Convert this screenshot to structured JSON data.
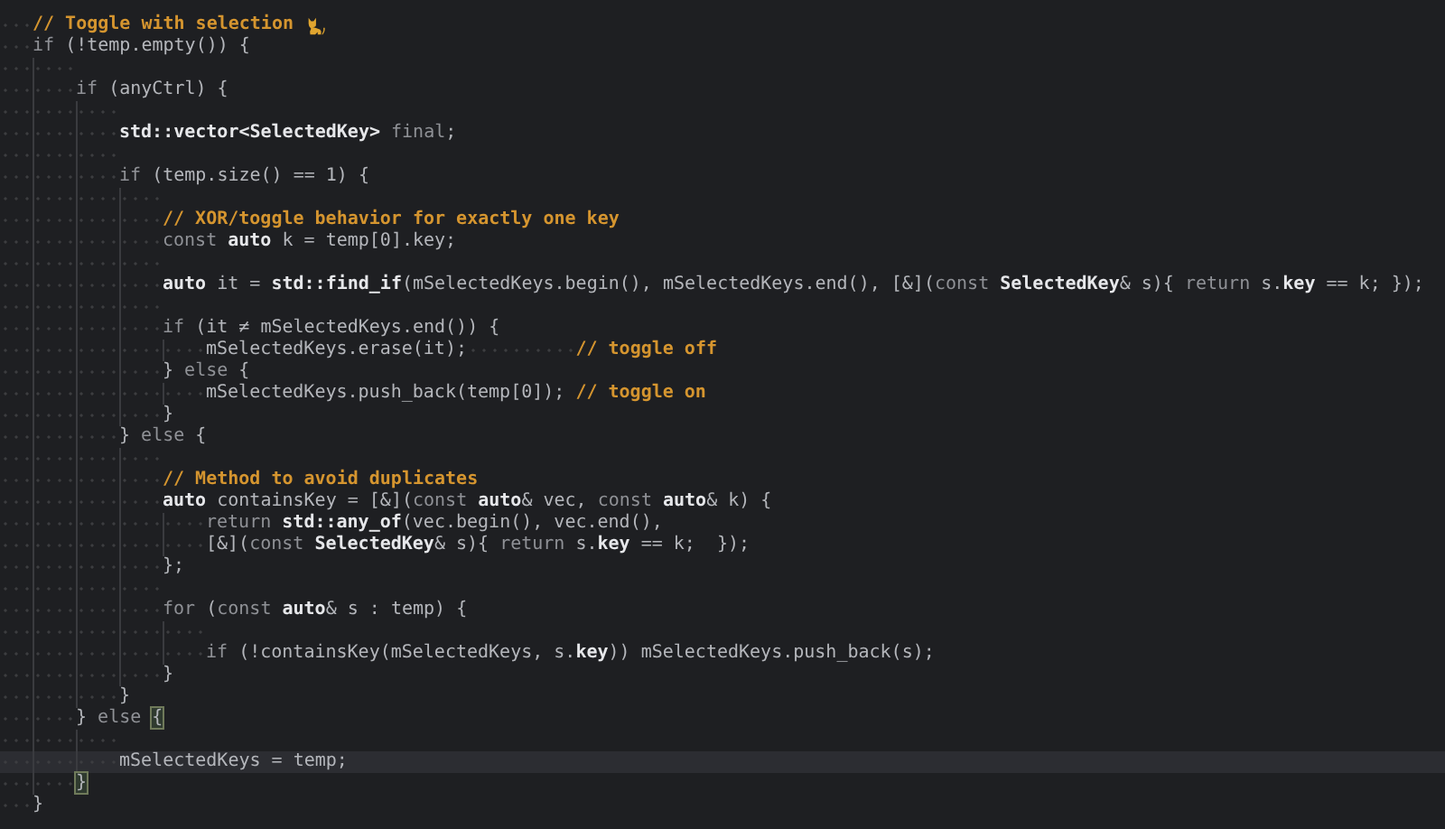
{
  "lines": [
    {
      "kind": "code",
      "current": false,
      "tokens": [
        {
          "kind": "comment",
          "text": "// Toggle with selection"
        },
        {
          "kind": "icon"
        }
      ]
    },
    {
      "kind": "code",
      "current": false,
      "tokens": [
        {
          "kind": "keyword",
          "text": "if"
        },
        {
          "kind": "plain",
          "text": " (!temp.empty()) {"
        }
      ],
      "children": [
        {
          "kind": "blank",
          "current": false
        },
        {
          "kind": "code",
          "current": false,
          "tokens": [
            {
              "kind": "keyword",
              "text": "if"
            },
            {
              "kind": "plain",
              "text": " (anyCtrl) {"
            }
          ],
          "children": [
            {
              "kind": "blank",
              "current": false
            },
            {
              "kind": "code",
              "current": false,
              "tokens": [
                {
                  "kind": "strong",
                  "text": "std::vector<SelectedKey>"
                },
                {
                  "kind": "keyword",
                  "text": " final"
                },
                {
                  "kind": "plain",
                  "text": ";"
                }
              ]
            },
            {
              "kind": "blank",
              "current": false
            },
            {
              "kind": "code",
              "current": false,
              "tokens": [
                {
                  "kind": "keyword",
                  "text": "if"
                },
                {
                  "kind": "plain",
                  "text": " (temp.size() == 1) {"
                }
              ],
              "children": [
                {
                  "kind": "blank",
                  "current": false
                },
                {
                  "kind": "code",
                  "current": false,
                  "tokens": [
                    {
                      "kind": "comment",
                      "text": "// XOR/toggle behavior for exactly one key"
                    }
                  ]
                },
                {
                  "kind": "code",
                  "current": false,
                  "tokens": [
                    {
                      "kind": "keyword",
                      "text": "const "
                    },
                    {
                      "kind": "strong",
                      "text": "auto"
                    },
                    {
                      "kind": "plain",
                      "text": " k = temp[0].key;"
                    }
                  ]
                },
                {
                  "kind": "blank",
                  "current": false
                },
                {
                  "kind": "code",
                  "current": false,
                  "tokens": [
                    {
                      "kind": "strong",
                      "text": "auto"
                    },
                    {
                      "kind": "plain",
                      "text": " it = "
                    },
                    {
                      "kind": "strong",
                      "text": "std::find_if"
                    },
                    {
                      "kind": "plain",
                      "text": "(mSelectedKeys.begin(), mSelectedKeys.end(), [&]("
                    },
                    {
                      "kind": "keyword",
                      "text": "const "
                    },
                    {
                      "kind": "strong",
                      "text": "SelectedKey"
                    },
                    {
                      "kind": "plain",
                      "text": "& s){ "
                    },
                    {
                      "kind": "keyword",
                      "text": "return"
                    },
                    {
                      "kind": "plain",
                      "text": " s."
                    },
                    {
                      "kind": "strong",
                      "text": "key"
                    },
                    {
                      "kind": "plain",
                      "text": " == k; });"
                    }
                  ]
                },
                {
                  "kind": "blank",
                  "current": false
                },
                {
                  "kind": "code",
                  "current": false,
                  "tokens": [
                    {
                      "kind": "keyword",
                      "text": "if"
                    },
                    {
                      "kind": "plain",
                      "text": " (it ≠ mSelectedKeys.end()) {"
                    }
                  ],
                  "children": [
                    {
                      "kind": "code",
                      "current": false,
                      "tokens": [
                        {
                          "kind": "plain",
                          "text": "mSelectedKeys.erase(it);"
                        },
                        {
                          "kind": "gap"
                        },
                        {
                          "kind": "comment",
                          "text": "// toggle off"
                        }
                      ]
                    }
                  ]
                },
                {
                  "kind": "code",
                  "current": false,
                  "tokens": [
                    {
                      "kind": "plain",
                      "text": "} "
                    },
                    {
                      "kind": "keyword",
                      "text": "else"
                    },
                    {
                      "kind": "plain",
                      "text": " {"
                    }
                  ],
                  "children": [
                    {
                      "kind": "code",
                      "current": false,
                      "tokens": [
                        {
                          "kind": "plain",
                          "text": "mSelectedKeys.push_back(temp[0]); "
                        },
                        {
                          "kind": "comment",
                          "text": "// toggle on"
                        }
                      ]
                    }
                  ]
                },
                {
                  "kind": "code",
                  "current": false,
                  "tokens": [
                    {
                      "kind": "plain",
                      "text": "}"
                    }
                  ]
                }
              ]
            },
            {
              "kind": "code",
              "current": false,
              "tokens": [
                {
                  "kind": "plain",
                  "text": "} "
                },
                {
                  "kind": "keyword",
                  "text": "else"
                },
                {
                  "kind": "plain",
                  "text": " {"
                }
              ],
              "children": [
                {
                  "kind": "blank",
                  "current": false
                },
                {
                  "kind": "code",
                  "current": false,
                  "tokens": [
                    {
                      "kind": "comment",
                      "text": "// Method to avoid duplicates"
                    }
                  ]
                },
                {
                  "kind": "code",
                  "current": false,
                  "tokens": [
                    {
                      "kind": "strong",
                      "text": "auto"
                    },
                    {
                      "kind": "plain",
                      "text": " containsKey = [&]("
                    },
                    {
                      "kind": "keyword",
                      "text": "const "
                    },
                    {
                      "kind": "strong",
                      "text": "auto"
                    },
                    {
                      "kind": "plain",
                      "text": "& vec, "
                    },
                    {
                      "kind": "keyword",
                      "text": "const "
                    },
                    {
                      "kind": "strong",
                      "text": "auto"
                    },
                    {
                      "kind": "plain",
                      "text": "& k) {"
                    }
                  ],
                  "children": [
                    {
                      "kind": "code",
                      "current": false,
                      "tokens": [
                        {
                          "kind": "keyword",
                          "text": "return "
                        },
                        {
                          "kind": "strong",
                          "text": "std::any_of"
                        },
                        {
                          "kind": "plain",
                          "text": "(vec.begin(), vec.end(),"
                        }
                      ]
                    },
                    {
                      "kind": "code",
                      "current": false,
                      "tokens": [
                        {
                          "kind": "plain",
                          "text": "[&]("
                        },
                        {
                          "kind": "keyword",
                          "text": "const "
                        },
                        {
                          "kind": "strong",
                          "text": "SelectedKey"
                        },
                        {
                          "kind": "plain",
                          "text": "& s){ "
                        },
                        {
                          "kind": "keyword",
                          "text": "return"
                        },
                        {
                          "kind": "plain",
                          "text": " s."
                        },
                        {
                          "kind": "strong",
                          "text": "key"
                        },
                        {
                          "kind": "plain",
                          "text": " == k;  });"
                        }
                      ]
                    }
                  ]
                },
                {
                  "kind": "code",
                  "current": false,
                  "tokens": [
                    {
                      "kind": "plain",
                      "text": "};"
                    }
                  ]
                },
                {
                  "kind": "blank",
                  "current": false
                },
                {
                  "kind": "code",
                  "current": false,
                  "tokens": [
                    {
                      "kind": "keyword",
                      "text": "for"
                    },
                    {
                      "kind": "plain",
                      "text": " ("
                    },
                    {
                      "kind": "keyword",
                      "text": "const "
                    },
                    {
                      "kind": "strong",
                      "text": "auto"
                    },
                    {
                      "kind": "plain",
                      "text": "& s : temp) {"
                    }
                  ],
                  "children": [
                    {
                      "kind": "blank",
                      "current": false
                    },
                    {
                      "kind": "code",
                      "current": false,
                      "tokens": [
                        {
                          "kind": "keyword",
                          "text": "if"
                        },
                        {
                          "kind": "plain",
                          "text": " (!containsKey(mSelectedKeys, s."
                        },
                        {
                          "kind": "strong",
                          "text": "key"
                        },
                        {
                          "kind": "plain",
                          "text": ")) mSelectedKeys.push_back(s);"
                        }
                      ]
                    }
                  ]
                },
                {
                  "kind": "code",
                  "current": false,
                  "tokens": [
                    {
                      "kind": "plain",
                      "text": "}"
                    }
                  ]
                }
              ]
            },
            {
              "kind": "code",
              "current": false,
              "tokens": [
                {
                  "kind": "plain",
                  "text": "}"
                }
              ]
            }
          ]
        },
        {
          "kind": "code",
          "current": false,
          "tokens": [
            {
              "kind": "plain",
              "text": "} "
            },
            {
              "kind": "keyword",
              "text": "else "
            },
            {
              "kind": "match",
              "text": "{"
            }
          ],
          "children": [
            {
              "kind": "blank",
              "current": false
            },
            {
              "kind": "code",
              "current": true,
              "tokens": [
                {
                  "kind": "plain",
                  "text": "mSelectedKeys = temp;"
                }
              ]
            }
          ]
        },
        {
          "kind": "code",
          "current": false,
          "tokens": [
            {
              "kind": "match",
              "text": "}"
            }
          ]
        }
      ]
    },
    {
      "kind": "code",
      "current": false,
      "tokens": [
        {
          "kind": "plain",
          "text": "}"
        }
      ]
    }
  ]
}
